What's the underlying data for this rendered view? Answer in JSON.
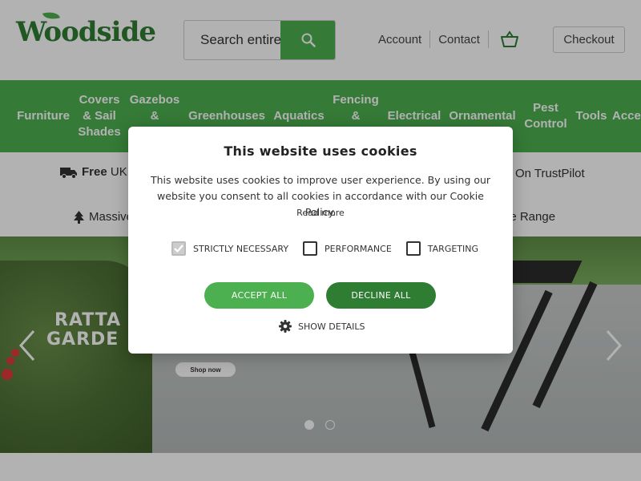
{
  "header": {
    "logo_text": "Woodside",
    "search": {
      "placeholder": "Search entire",
      "icon": "search-icon"
    },
    "links": [
      "Account",
      "Contact"
    ],
    "basket_icon": "basket-icon",
    "checkout_label": "Checkout"
  },
  "nav": {
    "items": [
      {
        "label": "Furniture"
      },
      {
        "label": "Covers & Sail Shades"
      },
      {
        "label": "Gazebos &"
      },
      {
        "label": "Greenhouses"
      },
      {
        "label": "Aquatics"
      },
      {
        "label": "Fencing &"
      },
      {
        "label": "Electrical"
      },
      {
        "label": "Ornamental"
      },
      {
        "label": "Pest Control"
      },
      {
        "label": "Tools"
      },
      {
        "label": "Acce"
      }
    ]
  },
  "usp": {
    "row1_left_bold": "Free",
    "row1_left_text": "UK",
    "row1_right": "On TrustPilot",
    "row2_left": "Massive",
    "row2_right": "ne Range"
  },
  "hero": {
    "title_line1": "RATTA",
    "title_line2": "GARDE",
    "cta": "Shop now",
    "slide_count": 2,
    "active_slide": 1
  },
  "cookie": {
    "title": "This website uses cookies",
    "text": "This website uses cookies to improve user experience. By using our website you consent to all cookies in accordance with our Cookie Policy.",
    "read_more": "Read more",
    "options": [
      {
        "label": "STRICTLY NECESSARY",
        "checked": true,
        "disabled": true
      },
      {
        "label": "PERFORMANCE",
        "checked": false
      },
      {
        "label": "TARGETING",
        "checked": false
      }
    ],
    "accept_label": "ACCEPT ALL",
    "decline_label": "DECLINE ALL",
    "details_label": "SHOW DETAILS"
  },
  "colors": {
    "brand_green": "#4caf50",
    "dark_green": "#2e7d32",
    "overlay": "rgba(0,0,0,0.3)"
  }
}
